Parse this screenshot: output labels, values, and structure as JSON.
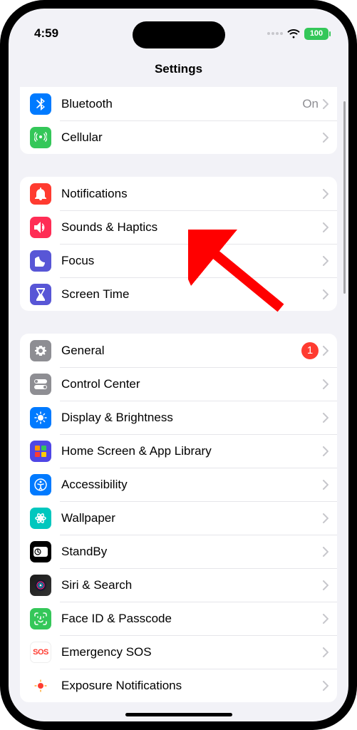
{
  "status": {
    "time": "4:59",
    "battery_pct": "100"
  },
  "header": {
    "title": "Settings"
  },
  "groups": [
    {
      "id": "connectivity",
      "rows": [
        {
          "id": "bluetooth",
          "label": "Bluetooth",
          "detail": "On",
          "icon": "bluetooth-icon",
          "bg": "bg-bt"
        },
        {
          "id": "cellular",
          "label": "Cellular",
          "icon": "antenna-icon",
          "bg": "bg-cell"
        }
      ]
    },
    {
      "id": "alerts",
      "rows": [
        {
          "id": "notifications",
          "label": "Notifications",
          "icon": "bell-icon",
          "bg": "bg-notif"
        },
        {
          "id": "sounds",
          "label": "Sounds & Haptics",
          "icon": "speaker-icon",
          "bg": "bg-sound"
        },
        {
          "id": "focus",
          "label": "Focus",
          "icon": "moon-icon",
          "bg": "bg-focus"
        },
        {
          "id": "screentime",
          "label": "Screen Time",
          "icon": "hourglass-icon",
          "bg": "bg-st"
        }
      ]
    },
    {
      "id": "system",
      "rows": [
        {
          "id": "general",
          "label": "General",
          "icon": "gear-icon",
          "bg": "bg-gen",
          "badge": "1"
        },
        {
          "id": "controlcenter",
          "label": "Control Center",
          "icon": "switches-icon",
          "bg": "bg-cc"
        },
        {
          "id": "display",
          "label": "Display & Brightness",
          "icon": "sun-icon",
          "bg": "bg-disp"
        },
        {
          "id": "homescreen",
          "label": "Home Screen & App Library",
          "icon": "grid-icon",
          "bg": "bg-home"
        },
        {
          "id": "accessibility",
          "label": "Accessibility",
          "icon": "person-icon",
          "bg": "bg-acc"
        },
        {
          "id": "wallpaper",
          "label": "Wallpaper",
          "icon": "flower-icon",
          "bg": "bg-wall"
        },
        {
          "id": "standby",
          "label": "StandBy",
          "icon": "clock-icon",
          "bg": "bg-standby"
        },
        {
          "id": "siri",
          "label": "Siri & Search",
          "icon": "siri-icon",
          "bg": "bg-siri"
        },
        {
          "id": "faceid",
          "label": "Face ID & Passcode",
          "icon": "faceid-icon",
          "bg": "bg-face"
        },
        {
          "id": "sos",
          "label": "Emergency SOS",
          "icon": "sos-icon",
          "bg": "bg-sos"
        },
        {
          "id": "exposure",
          "label": "Exposure Notifications",
          "icon": "exposure-icon",
          "bg": "bg-expo"
        }
      ]
    }
  ]
}
